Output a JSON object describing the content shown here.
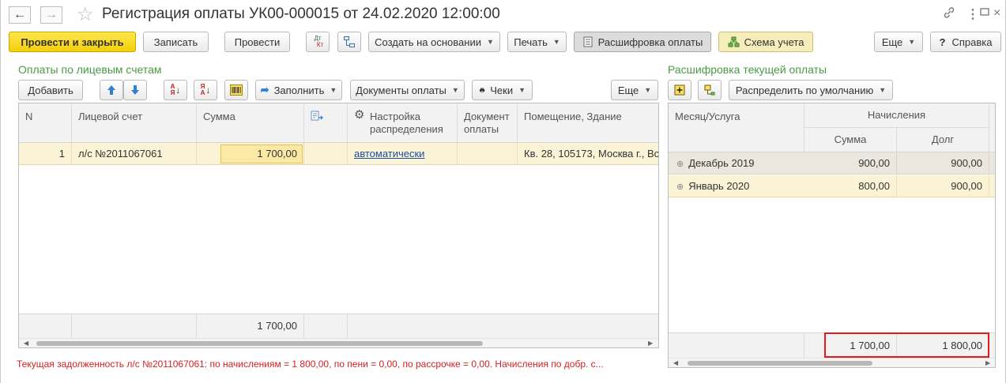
{
  "window": {
    "title": "Регистрация оплаты УК00-000015 от 24.02.2020 12:00:00",
    "back_icon": "arrow-left-icon",
    "forward_icon": "arrow-right-icon",
    "favorite_icon": "star-icon",
    "link_icon": "link-icon",
    "menu_icon": "more-vertical-icon",
    "maximize_icon": "maximize-icon",
    "close_icon": "close-icon"
  },
  "toolbar": {
    "post_close": "Провести и закрыть",
    "save": "Записать",
    "post": "Провести",
    "dtkt_dt": "Дт",
    "dtkt_kt": "Кт",
    "create_based": "Создать на основании",
    "print": "Печать",
    "decode": "Расшифровка оплаты",
    "scheme": "Схема учета",
    "more": "Еще",
    "help_q": "?",
    "help": "Справка"
  },
  "left": {
    "section_title": "Оплаты по лицевым счетам",
    "add": "Добавить",
    "fill": "Заполнить",
    "docs": "Документы оплаты",
    "checks": "Чеки",
    "more": "Еще",
    "sort_az": "АЯ",
    "columns": {
      "n": "N",
      "account": "Лицевой счет",
      "sum": "Сумма",
      "settings": "Настройка распределения",
      "doc": "Документ оплаты",
      "premises": "Помещение, Здание"
    },
    "rows": [
      {
        "n": "1",
        "account": "л/с №2011067061",
        "sum": "1 700,00",
        "settings": "автоматически",
        "doc": "",
        "premises": "Кв. 28, 105173, Москва г., Вс"
      }
    ],
    "total_sum": "1 700,00"
  },
  "right": {
    "section_title": "Расшифровка текущей оплаты",
    "distribute": "Распределить по умолчанию",
    "columns": {
      "month": "Месяц/Услуга",
      "charges": "Начисления",
      "sum": "Сумма",
      "debt": "Долг"
    },
    "rows": [
      {
        "month": "Декабрь 2019",
        "sum": "900,00",
        "debt": "900,00"
      },
      {
        "month": "Январь 2020",
        "sum": "800,00",
        "debt": "900,00"
      }
    ],
    "total_sum": "1 700,00",
    "total_debt": "1 800,00"
  },
  "status_text": "Текущая задолженность л/с №2011067061: по начислениям = 1 800,00, по пени = 0,00, по рассрочке = 0,00. Начисления по добр. с...",
  "colors": {
    "accent_green": "#4a9a43",
    "primary_yellow": "#f5cf0c",
    "status_red": "#d42020",
    "highlight_border": "#e01b1b"
  }
}
